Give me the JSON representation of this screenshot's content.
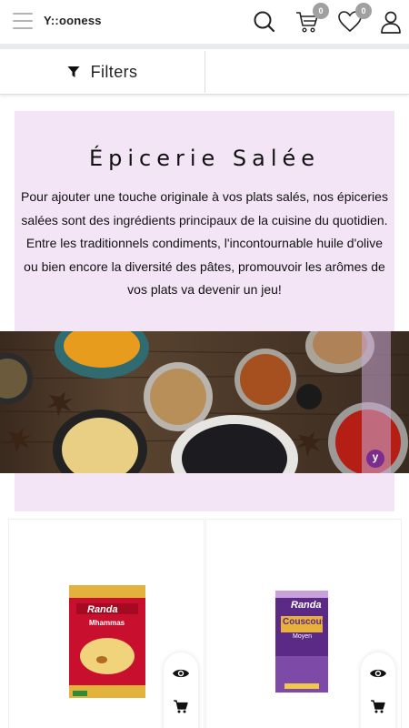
{
  "header": {
    "logo": "Y::ooness",
    "cart_count": "0",
    "wishlist_count": "0"
  },
  "filters": {
    "label": "Filters"
  },
  "category": {
    "title": "Épicerie Salée",
    "paragraph1": "Pour ajouter une touche originale à vos plats salés, nos épiceries salées sont des ingrédients principaux de la cuisine du quotidien.",
    "paragraph2": "Entre les traditionnels condiments, l'incontournable huile d'olive ou bien encore la diversité des pâtes, promouvoir les arômes de vos plats va devenir un jeu!",
    "image_badge": "y"
  },
  "products": [
    {
      "brand": "Randa",
      "name": "Mhammas"
    },
    {
      "brand": "Randa",
      "name": "Couscous",
      "variant": "Moyen"
    }
  ],
  "colors": {
    "banner_bg": "#f3e4f6",
    "badge_bg": "#a0a0a0",
    "brand_purple": "#7b2d8e",
    "product1_red": "#c8102e",
    "product2_purple": "#5b2a86"
  },
  "icons": [
    "menu-icon",
    "search-icon",
    "cart-icon",
    "heart-icon",
    "user-icon",
    "filter-icon",
    "eye-icon",
    "cart-add-icon"
  ]
}
